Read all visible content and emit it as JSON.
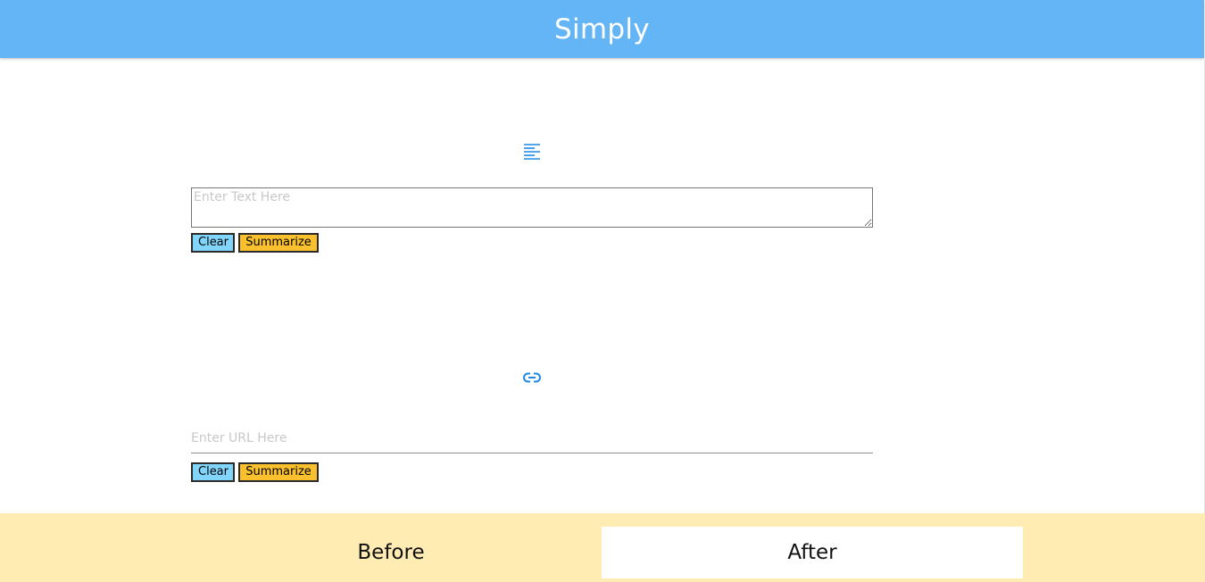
{
  "header": {
    "title": "Simply",
    "color": "#64b5f6"
  },
  "text_section": {
    "icon": "text-align-left-icon",
    "placeholder": "Enter Text Here",
    "value": "",
    "clear_label": "Clear",
    "summarize_label": "Summarize"
  },
  "url_section": {
    "icon": "link-icon",
    "placeholder": "Enter URL Here",
    "value": "",
    "clear_label": "Clear",
    "summarize_label": "Summarize"
  },
  "footer": {
    "background": "#ffecb3",
    "tabs": [
      {
        "label": "Before",
        "selected": false
      },
      {
        "label": "After",
        "selected": true
      }
    ]
  },
  "colors": {
    "accent": "#1e88e5",
    "clear_button": "#81d4fa",
    "summarize_button": "#fbc02d"
  }
}
